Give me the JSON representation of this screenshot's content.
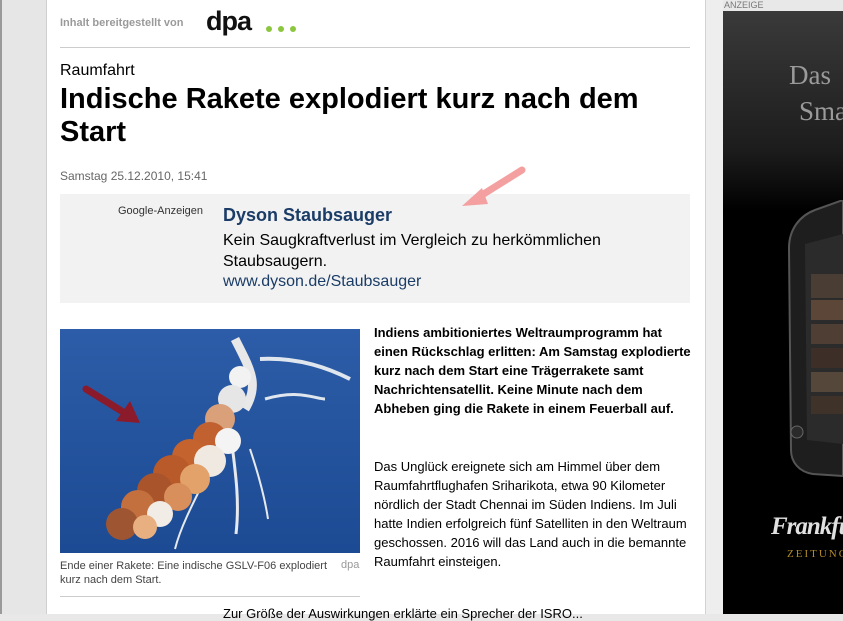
{
  "provider": {
    "label": "Inhalt bereitgestellt von",
    "logo_text": "dpa",
    "dot_color": "#8cc63f"
  },
  "article": {
    "kicker": "Raumfahrt",
    "headline": "Indische Rakete explodiert kurz nach dem Start",
    "dateline": "Samstag 25.12.2010, 15:41",
    "lead": "Indiens ambitioniertes Weltraumprogramm hat einen Rückschlag erlitten: Am Samstag explodierte kurz nach dem Start eine Trägerrakete samt Nachrichtensatellit. Keine Minute nach dem Abheben ging die Rakete in einem Feuerball auf.",
    "body": "Das Unglück ereignete sich am Himmel über dem Raumfahrtflughafen Sriharikota, etwa 90 Kilometer nördlich der Stadt Chennai im Süden Indiens. Im Juli hatte Indien erfolgreich fünf Satelliten in den Weltraum geschossen. 2016 will das Land auch in die bemannte Raumfahrt einsteigen.",
    "tail": "Zur Größe der Auswirkungen erklärte ein Sprecher der ISRO..."
  },
  "google_ad": {
    "label": "Google-Anzeigen",
    "title": "Dyson Staubsauger",
    "text": "Kein Saugkraftverlust im Vergleich zu herkömmlichen Staubsaugern.",
    "url": "www.dyson.de/Staubsauger",
    "title_color": "#1a3c66"
  },
  "image": {
    "caption": "Ende einer Rakete: Eine indische GSLV-F06 explodiert kurz nach dem Start.",
    "credit": "dpa"
  },
  "side_ad": {
    "label": "ANZEIGE",
    "line1": "Das",
    "line2": "Sma",
    "brand": "Frankfu",
    "subbrand": "ZEITUNG"
  },
  "colors": {
    "annotation_pink": "#f4a0a0",
    "annotation_red": "#8b1a2b"
  }
}
